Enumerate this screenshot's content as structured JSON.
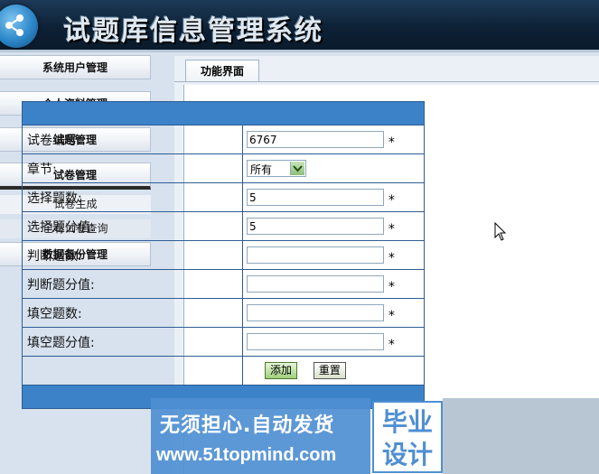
{
  "header": {
    "title": "试题库信息管理系统",
    "logo_icon": "share-icon"
  },
  "sidebar": {
    "menus": [
      {
        "label": "系统用户管理"
      },
      {
        "label": "个人资料管理"
      },
      {
        "label": "试题管理"
      },
      {
        "label": "试卷管理"
      },
      {
        "label": "数据备份管理"
      }
    ],
    "sub_items": [
      {
        "label": "试卷生成"
      },
      {
        "label": "已有试卷查询"
      }
    ]
  },
  "main": {
    "tab_label": "功能界面",
    "form": {
      "rows": [
        {
          "label": "试卷编号:",
          "value": "6767",
          "required": "*"
        },
        {
          "label": "章节:",
          "select_value": "所有"
        },
        {
          "label": "选择题数:",
          "value": "5",
          "required": "*"
        },
        {
          "label": "选择题分值:",
          "value": "5",
          "required": "*"
        },
        {
          "label": "判断题数:",
          "value": "",
          "required": "*"
        },
        {
          "label": "判断题分值:",
          "value": "",
          "required": "*"
        },
        {
          "label": "填空题数:",
          "value": "",
          "required": "*"
        },
        {
          "label": "填空题分值:",
          "value": "",
          "required": "*"
        }
      ],
      "add_button": "添加",
      "reset_button": "重置"
    }
  },
  "watermark": {
    "line1": "无须担心.自动发货",
    "line2": "www.51topmind.com",
    "box_text_1": "毕业",
    "box_text_2": "设计"
  },
  "colors": {
    "accent": "#3c82c8",
    "header_bg": "#0d2034",
    "page_bg": "#d7e2ee"
  }
}
